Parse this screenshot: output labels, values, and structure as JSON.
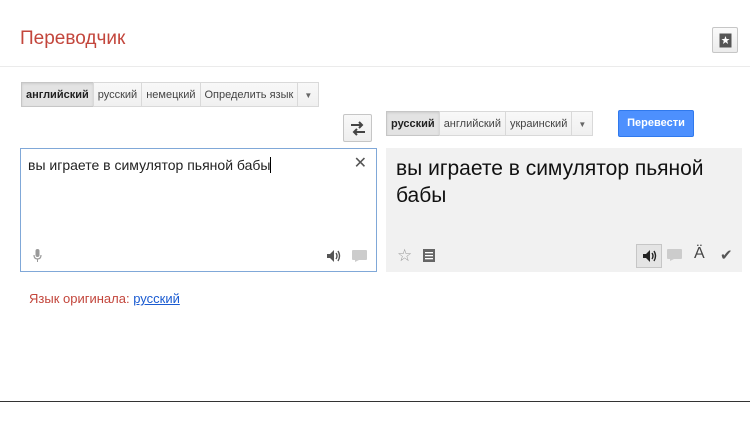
{
  "app": {
    "title": "Переводчик",
    "saved_icon": "phrasebook-star-icon"
  },
  "source": {
    "langs": [
      {
        "label": "английский",
        "active": true
      },
      {
        "label": "русский",
        "active": false
      },
      {
        "label": "немецкий",
        "active": false
      },
      {
        "label": "Определить язык",
        "active": false
      }
    ],
    "text": "вы играете в симулятор пьяной бабы",
    "detected_prefix": "Язык оригинала:",
    "detected_lang": "русский"
  },
  "target": {
    "langs": [
      {
        "label": "русский",
        "active": true
      },
      {
        "label": "английский",
        "active": false
      },
      {
        "label": "украинский",
        "active": false
      }
    ],
    "text": "вы играете в симулятор пьяной бабы",
    "translate_label": "Перевести"
  },
  "colors": {
    "accent": "#4d90fe",
    "title": "#c3463c",
    "link": "#1a5bd1"
  }
}
